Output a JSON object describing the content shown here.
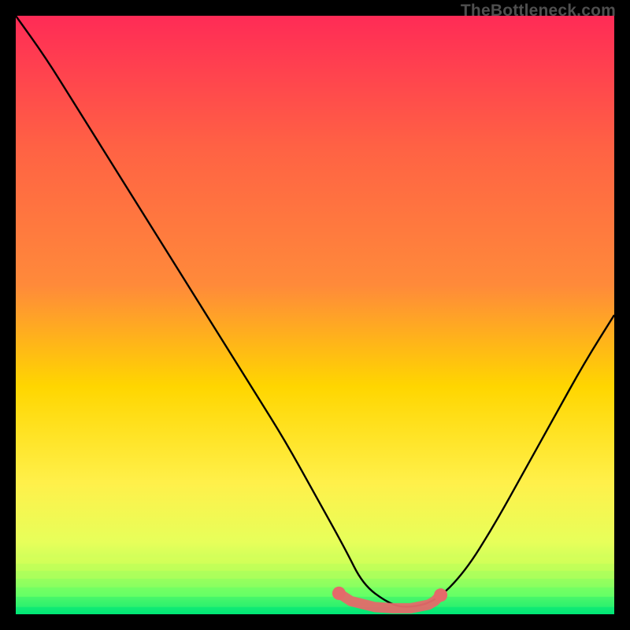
{
  "watermark": "TheBottleneck.com",
  "chart_data": {
    "type": "line",
    "title": "",
    "xlabel": "",
    "ylabel": "",
    "xlim": [
      0,
      100
    ],
    "ylim": [
      0,
      100
    ],
    "background_gradient": {
      "top": "#ff2b56",
      "mid_upper": "#ff8a3a",
      "mid": "#ffd600",
      "mid_lower": "#fff04a",
      "lower": "#e7ff5a",
      "bottom": "#00e676"
    },
    "series": [
      {
        "name": "bottleneck-curve",
        "color": "#000000",
        "x": [
          0,
          5,
          10,
          15,
          20,
          25,
          30,
          35,
          40,
          45,
          50,
          55,
          58,
          62,
          65,
          70,
          75,
          80,
          85,
          90,
          95,
          100
        ],
        "values": [
          100,
          93,
          85,
          77,
          69,
          61,
          53,
          45,
          37,
          29,
          20,
          11,
          5,
          2,
          1,
          2,
          7,
          15,
          24,
          33,
          42,
          50
        ]
      },
      {
        "name": "optimal-marker",
        "color": "#e46a6a",
        "type": "scatter",
        "x": [
          54,
          56,
          60,
          63,
          66,
          69,
          70,
          71
        ],
        "values": [
          3.5,
          2.2,
          1.2,
          1.0,
          1.0,
          1.6,
          2.2,
          3.2
        ]
      }
    ]
  }
}
